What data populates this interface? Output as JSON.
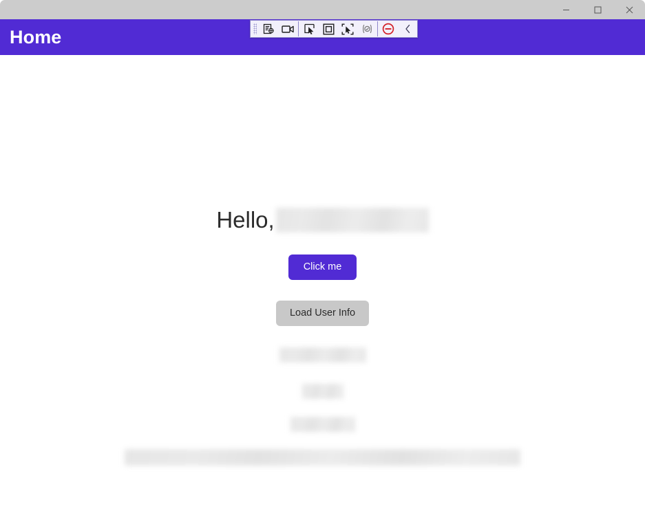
{
  "window": {
    "titlebar_background": "#cccccc",
    "controls": [
      {
        "name": "minimize",
        "glyph": "minimize-icon",
        "label": "Minimize"
      },
      {
        "name": "maximize",
        "glyph": "maximize-icon",
        "label": "Maximize"
      },
      {
        "name": "close",
        "glyph": "close-icon",
        "label": "Close"
      }
    ]
  },
  "automation_toolbar": {
    "background": "#f2f0fb",
    "border_color": "#8d86c9",
    "accent_stop": "#d32027",
    "items": [
      {
        "name": "drag-handle",
        "icon": "grip-dots-icon",
        "label": "Drag toolbar"
      },
      {
        "name": "inspect-element",
        "icon": "inspect-element-icon",
        "label": "Inspect element"
      },
      {
        "name": "record",
        "icon": "video-camera-icon",
        "label": "Record"
      },
      {
        "name": "select-cursor",
        "icon": "cursor-select-icon",
        "label": "Select"
      },
      {
        "name": "select-region",
        "icon": "square-region-icon",
        "label": "Select region"
      },
      {
        "name": "select-element",
        "icon": "element-picker-icon",
        "label": "Pick element"
      },
      {
        "name": "validate",
        "icon": "check-badge-icon",
        "label": "Validate"
      },
      {
        "name": "stop",
        "icon": "stop-circle-icon",
        "label": "Stop"
      },
      {
        "name": "collapse",
        "icon": "chevron-left-icon",
        "label": "Collapse"
      }
    ]
  },
  "app_header": {
    "title": "Home",
    "background": "#512bd4",
    "text_color": "#ffffff"
  },
  "main": {
    "greeting_prefix": "Hello,",
    "greeting_value_redacted": true,
    "primary_button": "Click me",
    "secondary_button": "Load User Info",
    "info_lines_redacted": 3,
    "footer_bar_redacted": true
  }
}
